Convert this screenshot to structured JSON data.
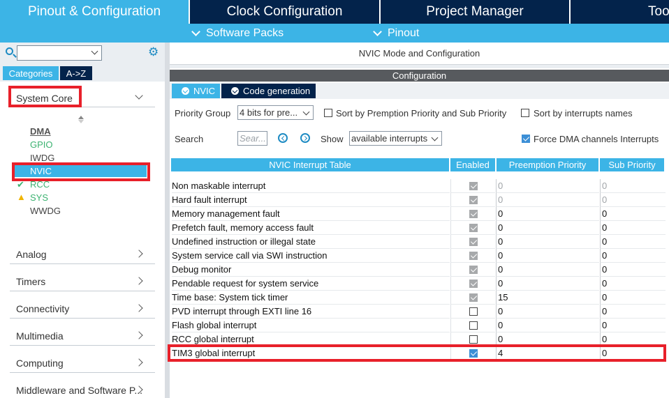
{
  "top_tabs": [
    {
      "label": "Pinout & Configuration",
      "active": true
    },
    {
      "label": "Clock Configuration",
      "active": false
    },
    {
      "label": "Project Manager",
      "active": false
    },
    {
      "label": "Too",
      "active": false
    }
  ],
  "subbar": {
    "software_packs": "Software Packs",
    "pinout": "Pinout"
  },
  "left": {
    "search_value": "",
    "tabs": {
      "categories": "Categories",
      "az": "A->Z"
    },
    "system_core": {
      "label": "System Core",
      "items": [
        {
          "label": "DMA",
          "status": "bold"
        },
        {
          "label": "GPIO",
          "status": "green"
        },
        {
          "label": "IWDG",
          "status": "normal"
        },
        {
          "label": "NVIC",
          "status": "selected"
        },
        {
          "label": "RCC",
          "status": "check"
        },
        {
          "label": "SYS",
          "status": "warning"
        },
        {
          "label": "WWDG",
          "status": "normal"
        }
      ]
    },
    "categories": [
      "Analog",
      "Timers",
      "Connectivity",
      "Multimedia",
      "Computing",
      "Middleware and Software P..."
    ]
  },
  "right": {
    "mode_title": "NVIC Mode and Configuration",
    "config_title": "Configuration",
    "config_tabs": [
      "NVIC",
      "Code generation"
    ],
    "priority_group_label": "Priority Group",
    "priority_group_value": "4 bits for pre...",
    "sort_premption_label": "Sort by Premption Priority and Sub Priority",
    "sort_names_label": "Sort by interrupts names",
    "search_label": "Search",
    "search_placeholder": "Sear...",
    "show_label": "Show",
    "show_value": "available interrupts",
    "force_dma_label": "Force DMA channels Interrupts",
    "table": {
      "headers": [
        "NVIC Interrupt Table",
        "Enabled",
        "Preemption Priority",
        "Sub Priority"
      ],
      "rows": [
        {
          "name": "Non maskable interrupt",
          "enabled": "grey",
          "preemption": "0",
          "sub": "0",
          "muted": true
        },
        {
          "name": "Hard fault interrupt",
          "enabled": "grey",
          "preemption": "0",
          "sub": "0",
          "muted": true
        },
        {
          "name": "Memory management fault",
          "enabled": "grey",
          "preemption": "0",
          "sub": "0",
          "muted": false
        },
        {
          "name": "Prefetch fault, memory access fault",
          "enabled": "grey",
          "preemption": "0",
          "sub": "0",
          "muted": false
        },
        {
          "name": "Undefined instruction or illegal state",
          "enabled": "grey",
          "preemption": "0",
          "sub": "0",
          "muted": false
        },
        {
          "name": "System service call via SWI instruction",
          "enabled": "grey",
          "preemption": "0",
          "sub": "0",
          "muted": false
        },
        {
          "name": "Debug monitor",
          "enabled": "grey",
          "preemption": "0",
          "sub": "0",
          "muted": false
        },
        {
          "name": "Pendable request for system service",
          "enabled": "grey",
          "preemption": "0",
          "sub": "0",
          "muted": false
        },
        {
          "name": "Time base: System tick timer",
          "enabled": "grey",
          "preemption": "15",
          "sub": "0",
          "muted": false
        },
        {
          "name": "PVD interrupt through EXTI line 16",
          "enabled": "off",
          "preemption": "0",
          "sub": "0",
          "muted": false
        },
        {
          "name": "Flash global interrupt",
          "enabled": "off",
          "preemption": "0",
          "sub": "0",
          "muted": false
        },
        {
          "name": "RCC global interrupt",
          "enabled": "off",
          "preemption": "0",
          "sub": "0",
          "muted": false
        },
        {
          "name": "TIM3 global interrupt",
          "enabled": "on",
          "preemption": "4",
          "sub": "0",
          "muted": false
        }
      ]
    }
  },
  "colors": {
    "navy": "#03234b",
    "accent": "#3cb4e6",
    "highlight_red": "#e8202a",
    "status_green": "#3cb371",
    "warning_yellow": "#f0b400"
  }
}
